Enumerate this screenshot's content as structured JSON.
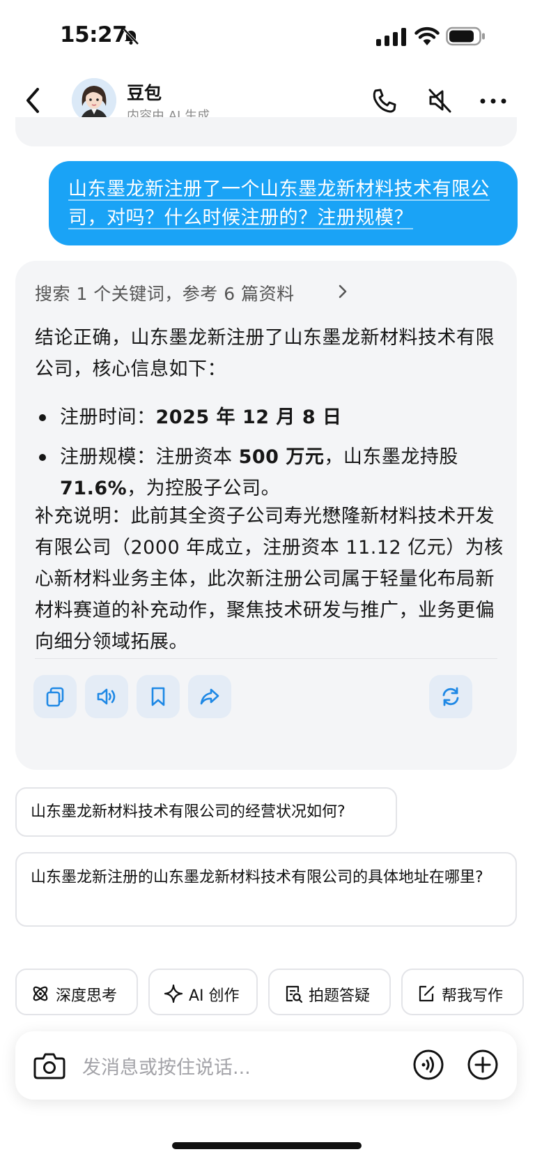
{
  "status_bar": {
    "time": "15:27"
  },
  "header": {
    "bot_name": "豆包",
    "subtitle": "内容由 AI 生成"
  },
  "user_message": "山东墨龙新注册了一个山东墨龙新材料技术有限公司，对吗？什么时候注册的？注册规模？",
  "answer": {
    "search_summary": "搜索 1 个关键词，参考 6 篇资料",
    "intro": "结论正确，山东墨龙新注册了山东墨龙新材料技术有限公司，核心信息如下：",
    "bullets": [
      {
        "label": "注册时间：",
        "value": "2025 年 12 月 8 日",
        "rest": ""
      },
      {
        "label": "注册规模：注册资本 ",
        "value": "500 万元",
        "rest": "，山东墨龙持股 ",
        "value2": "71.6%",
        "rest2": "，为控股子公司。"
      }
    ],
    "supplement": "补充说明：此前其全资子公司寿光懋隆新材料技术开发有限公司（2000 年成立，注册资本 11.12 亿元）为核心新材料业务主体，此次新注册公司属于轻量化布局新材料赛道的补充动作，聚焦技术研发与推广，业务更偏向细分领域拓展。"
  },
  "suggestions": [
    "山东墨龙新材料技术有限公司的经营状况如何?",
    "山东墨龙新注册的山东墨龙新材料技术有限公司的具体地址在哪里?"
  ],
  "tools": [
    "深度思考",
    "AI 创作",
    "拍题答疑",
    "帮我写作"
  ],
  "input": {
    "placeholder": "发消息或按住说话..."
  },
  "colors": {
    "accent": "#1aa3f6",
    "card_bg": "#f4f5f7",
    "action_bg": "#e4ecf6",
    "icon_blue": "#1e88e5"
  }
}
